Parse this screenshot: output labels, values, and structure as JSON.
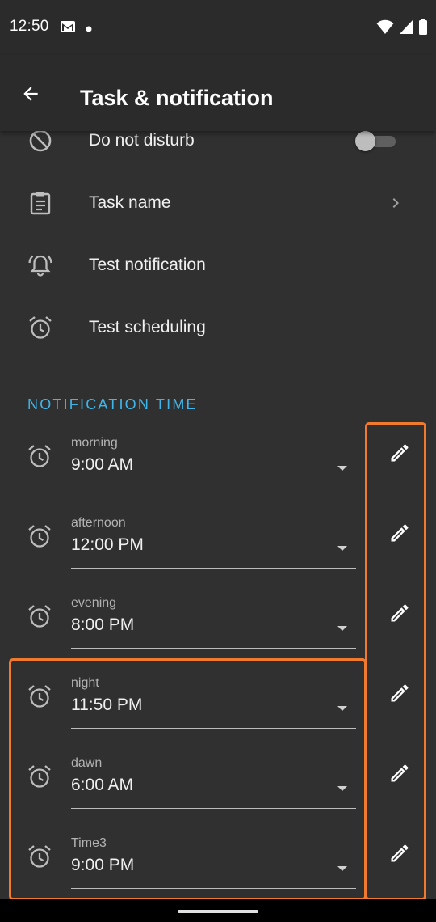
{
  "status_bar": {
    "time": "12:50",
    "icons": [
      "gmail-icon",
      "notification-dot-icon",
      "wifi-icon",
      "signal-icon",
      "battery-icon"
    ]
  },
  "app_bar": {
    "title": "Task & notification",
    "back_icon": "back-arrow-icon"
  },
  "settings": [
    {
      "icon": "do-not-disturb-icon",
      "label": "Do not disturb",
      "control": "toggle",
      "on": false
    },
    {
      "icon": "clipboard-icon",
      "label": "Task name",
      "control": "chevron"
    },
    {
      "icon": "alarm-bell-icon",
      "label": "Test notification",
      "control": "none"
    },
    {
      "icon": "alarm-icon",
      "label": "Test scheduling",
      "control": "none"
    }
  ],
  "notification_time": {
    "header": "NOTIFICATION TIME",
    "items": [
      {
        "label": "morning",
        "value": "9:00 AM"
      },
      {
        "label": "afternoon",
        "value": "12:00 PM"
      },
      {
        "label": "evening",
        "value": "8:00 PM"
      },
      {
        "label": "night",
        "value": "11:50 PM"
      },
      {
        "label": "dawn",
        "value": "6:00 AM"
      },
      {
        "label": "Time3",
        "value": "9:00 PM"
      }
    ]
  },
  "colors": {
    "background": "#303030",
    "app_bar": "#2b2b2b",
    "accent": "#3fb5e9",
    "highlight": "#f07a2e"
  }
}
